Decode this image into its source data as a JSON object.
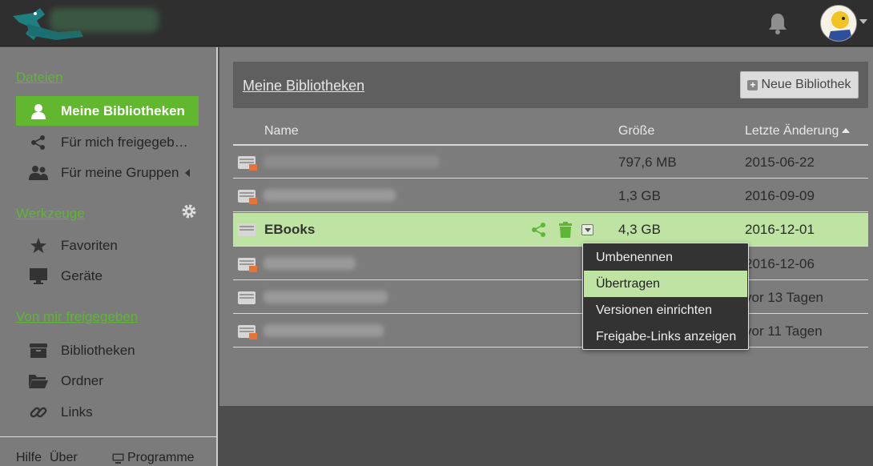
{
  "colors": {
    "accent": "#61b72e",
    "highlight_row": "#bfe3a3",
    "topbar": "#2f2f2f"
  },
  "header": {
    "bell_icon": "bell-icon",
    "avatar": "user-avatar"
  },
  "sidebar": {
    "sections": [
      {
        "heading": "Dateien",
        "items": [
          {
            "label": "Meine Bibliotheken",
            "icon": "user-icon",
            "active": true
          },
          {
            "label": "Für mich freigegeben",
            "icon": "share-icon"
          },
          {
            "label": "Für meine Gruppen",
            "icon": "group-icon"
          }
        ]
      },
      {
        "heading": "Werkzeuge",
        "items": [
          {
            "label": "Favoriten",
            "icon": "star-icon"
          },
          {
            "label": "Geräte",
            "icon": "monitor-icon"
          }
        ]
      },
      {
        "heading": "Von mir freigegeben",
        "items": [
          {
            "label": "Bibliotheken",
            "icon": "archive-icon"
          },
          {
            "label": "Ordner",
            "icon": "folder-icon"
          },
          {
            "label": "Links",
            "icon": "link-icon"
          }
        ]
      }
    ],
    "footer": {
      "help": "Hilfe",
      "about": "Über",
      "programs": "Programme"
    }
  },
  "main": {
    "title": "Meine Bibliotheken",
    "new_library_label": "Neue Bibliothek",
    "columns": {
      "name": "Name",
      "size": "Größe",
      "modified": "Letzte Änderung"
    },
    "rows": [
      {
        "name": "",
        "size": "797,6 MB",
        "modified": "2015-06-22"
      },
      {
        "name": "",
        "size": "1,3 GB",
        "modified": "2016-09-09"
      },
      {
        "name": "EBooks",
        "size": "4,3 GB",
        "modified": "2016-12-01"
      },
      {
        "name": "",
        "size": "",
        "modified": "2016-12-06"
      },
      {
        "name": "",
        "size": "",
        "modified": "vor 13 Tagen"
      },
      {
        "name": "",
        "size": "",
        "modified": "vor 11 Tagen"
      }
    ]
  },
  "menu": {
    "items": [
      "Umbenennen",
      "Übertragen",
      "Versionen einrichten",
      "Freigabe-Links anzeigen"
    ]
  }
}
